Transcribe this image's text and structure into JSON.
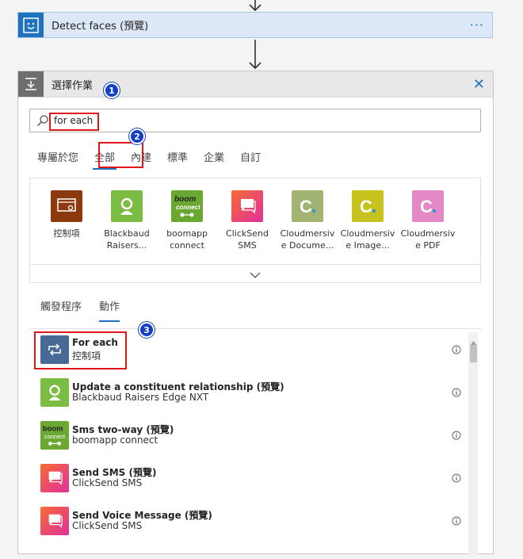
{
  "detect_card": {
    "title": "Detect faces (預覽)",
    "more": "···",
    "icon": "smiley-face-icon"
  },
  "panel": {
    "title": "選擇作業",
    "close": "✕",
    "icon": "download-tray-icon",
    "badges": [
      "1",
      "2",
      "3"
    ]
  },
  "search": {
    "value": "for each",
    "placeholder": ""
  },
  "tabs": [
    {
      "label": "專屬於您",
      "active": false
    },
    {
      "label": "全部",
      "active": true
    },
    {
      "label": "內建",
      "active": false
    },
    {
      "label": "標準",
      "active": false
    },
    {
      "label": "企業",
      "active": false
    },
    {
      "label": "自訂",
      "active": false
    }
  ],
  "connectors": [
    {
      "label_line1": "控制項",
      "label_line2": "",
      "color": "#8b3a0f",
      "icon": "control-icon"
    },
    {
      "label_line1": "Blackbaud",
      "label_line2": "Raisers...",
      "color": "#7bbd42",
      "icon": "blackbaud-icon"
    },
    {
      "label_line1": "boomapp",
      "label_line2": "connect",
      "color": "#6aa832",
      "icon": "boomapp-icon"
    },
    {
      "label_line1": "ClickSend",
      "label_line2": "SMS",
      "color": "#f3457f",
      "icon": "clicksend-icon"
    },
    {
      "label_line1": "Cloudmersiv",
      "label_line2": "e Docume...",
      "color": "#9fb571",
      "icon": "cloudmersive-document-icon"
    },
    {
      "label_line1": "Cloudmersiv",
      "label_line2": "e Image...",
      "color": "#c7c21e",
      "icon": "cloudmersive-image-icon"
    },
    {
      "label_line1": "Cloudmersiv",
      "label_line2": "e PDF",
      "color": "#e288c4",
      "icon": "cloudmersive-pdf-icon"
    }
  ],
  "subtabs": [
    {
      "label": "觸發程序",
      "active": false
    },
    {
      "label": "動作",
      "active": true
    }
  ],
  "actions": [
    {
      "title": "For each",
      "subtitle": "控制項",
      "color": "#476a94",
      "icon": "loop-icon"
    },
    {
      "title": "Update a constituent relationship (預覽)",
      "subtitle": "Blackbaud Raisers Edge NXT",
      "color": "#7bbd42",
      "icon": "blackbaud-icon"
    },
    {
      "title": "Sms two-way (預覽)",
      "subtitle": "boomapp connect",
      "color": "#6aa832",
      "icon": "boomapp-icon"
    },
    {
      "title": "Send SMS (預覽)",
      "subtitle": "ClickSend SMS",
      "color": "#f3457f",
      "icon": "clicksend-icon"
    },
    {
      "title": "Send Voice Message (預覽)",
      "subtitle": "ClickSend SMS",
      "color": "#f3457f",
      "icon": "clicksend-icon"
    }
  ],
  "colors": {
    "accent": "#1f72be",
    "highlight": "#e0161b",
    "badge": "#1540c6"
  }
}
